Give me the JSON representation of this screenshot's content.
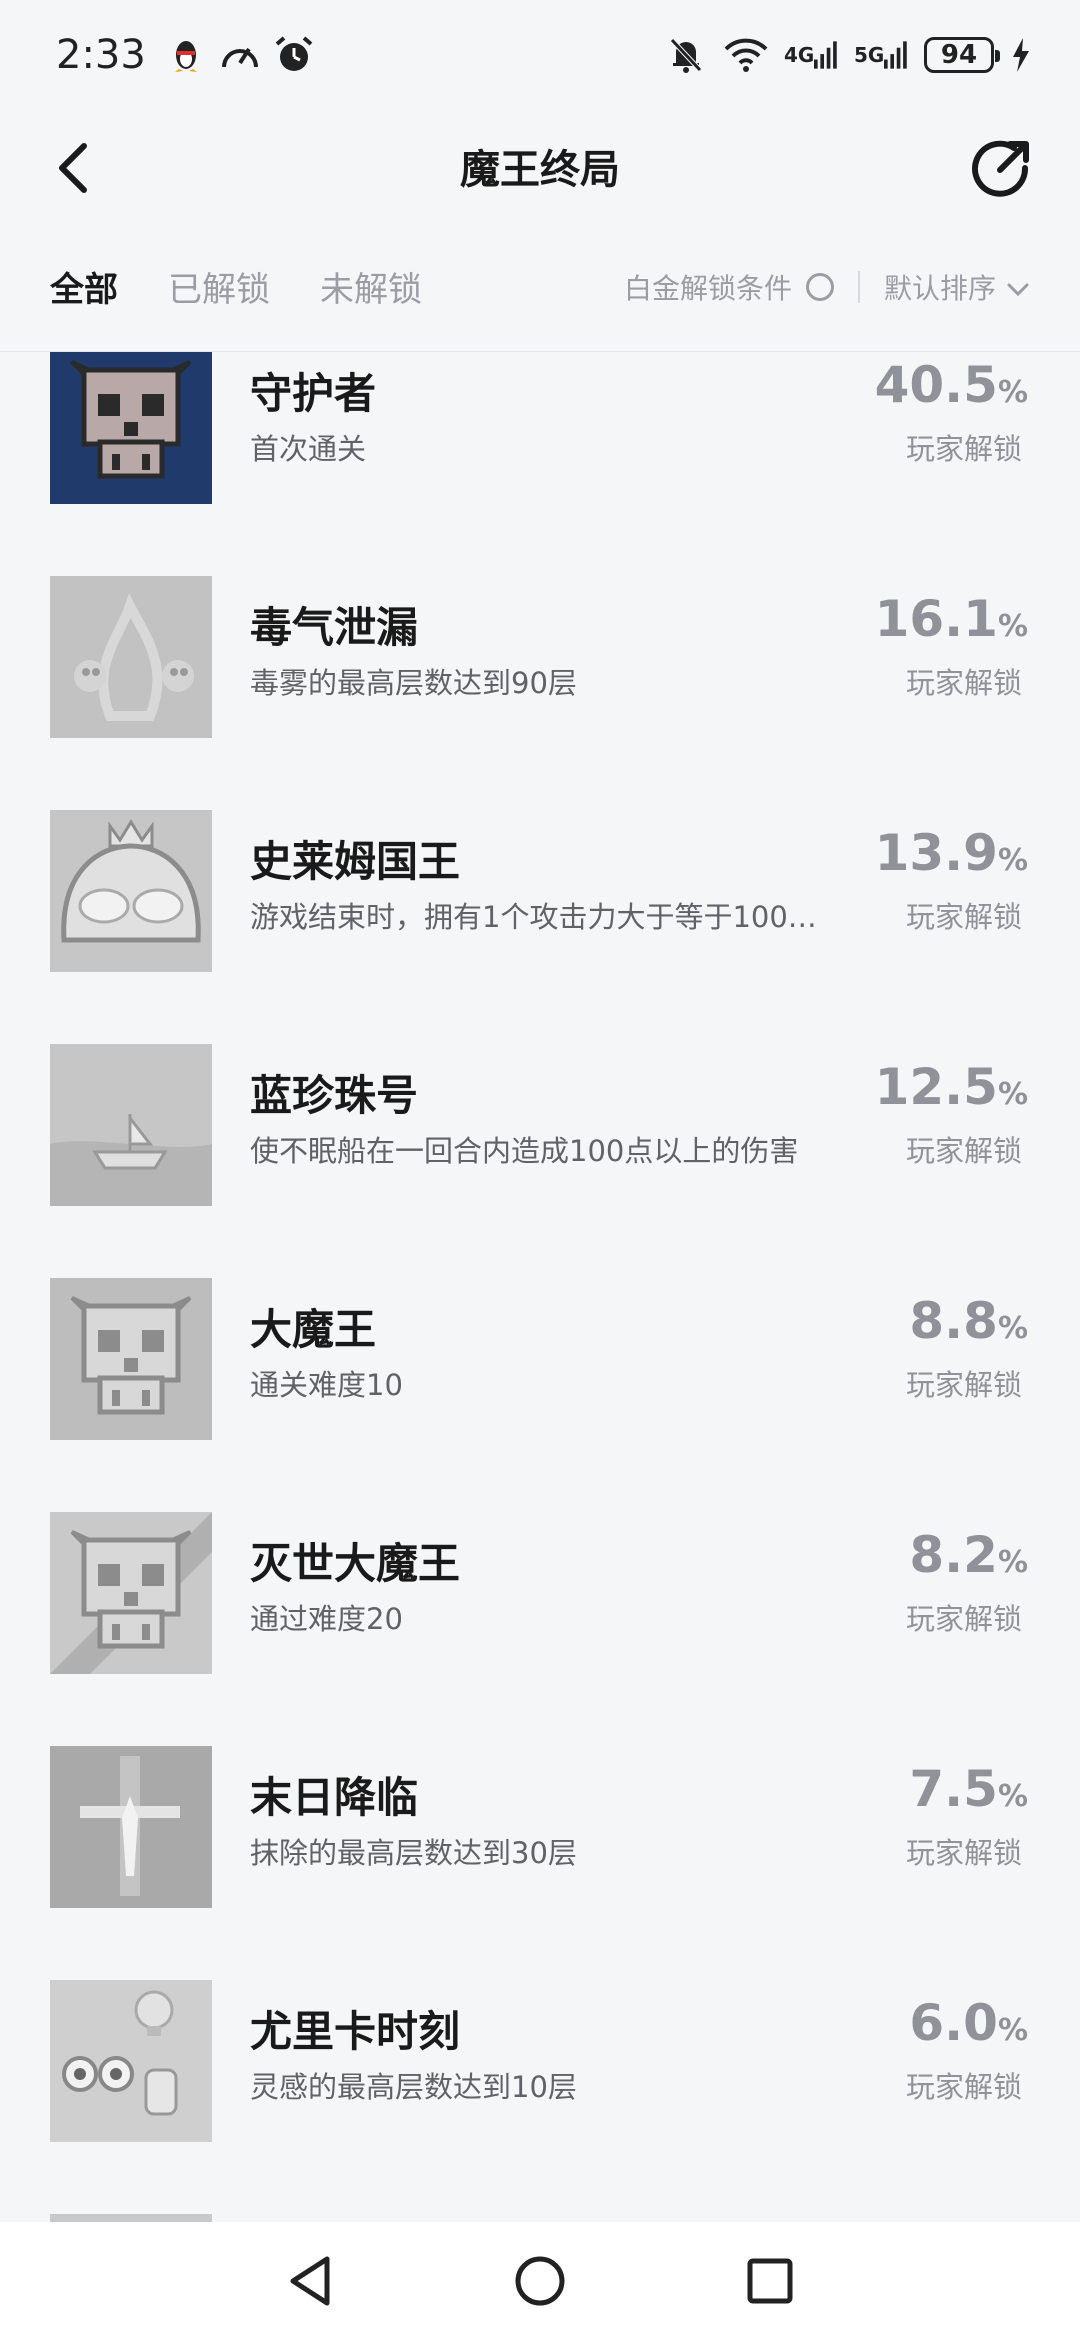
{
  "status_bar": {
    "time": "2:33",
    "net_4g": "4G",
    "net_5g": "5G",
    "battery": "94"
  },
  "header": {
    "title": "魔王终局"
  },
  "tabs": {
    "all": "全部",
    "unlocked": "已解锁",
    "locked": "未解锁",
    "platinum_condition": "白金解锁条件",
    "sort": "默认排序"
  },
  "achievements": [
    {
      "title": "守护者",
      "desc": "首次通关",
      "percent": "40.5",
      "unit": "%",
      "unlock_label": "玩家解锁",
      "icon": "skull-demon-icon",
      "unlocked": true
    },
    {
      "title": "毒气泄漏",
      "desc": "毒雾的最高层数达到90层",
      "percent": "16.1",
      "unit": "%",
      "unlock_label": "玩家解锁",
      "icon": "poison-ghost-icon",
      "unlocked": false
    },
    {
      "title": "史莱姆国王",
      "desc": "游戏结束时，拥有1个攻击力大于等于100…",
      "percent": "13.9",
      "unit": "%",
      "unlock_label": "玩家解锁",
      "icon": "slime-king-icon",
      "unlocked": false
    },
    {
      "title": "蓝珍珠号",
      "desc": "使不眠船在一回合内造成100点以上的伤害",
      "percent": "12.5",
      "unit": "%",
      "unlock_label": "玩家解锁",
      "icon": "ship-icon",
      "unlocked": false
    },
    {
      "title": "大魔王",
      "desc": "通关难度10",
      "percent": "8.8",
      "unit": "%",
      "unlock_label": "玩家解锁",
      "icon": "skull-demon-icon",
      "unlocked": false
    },
    {
      "title": "灭世大魔王",
      "desc": "通过难度20",
      "percent": "8.2",
      "unit": "%",
      "unlock_label": "玩家解锁",
      "icon": "skull-demon-striped-icon",
      "unlocked": false
    },
    {
      "title": "末日降临",
      "desc": "抹除的最高层数达到30层",
      "percent": "7.5",
      "unit": "%",
      "unlock_label": "玩家解锁",
      "icon": "cross-icon",
      "unlocked": false
    },
    {
      "title": "尤里卡时刻",
      "desc": "灵感的最高层数达到10层",
      "percent": "6.0",
      "unit": "%",
      "unlock_label": "玩家解锁",
      "icon": "eureka-bulb-icon",
      "unlocked": false
    }
  ]
}
